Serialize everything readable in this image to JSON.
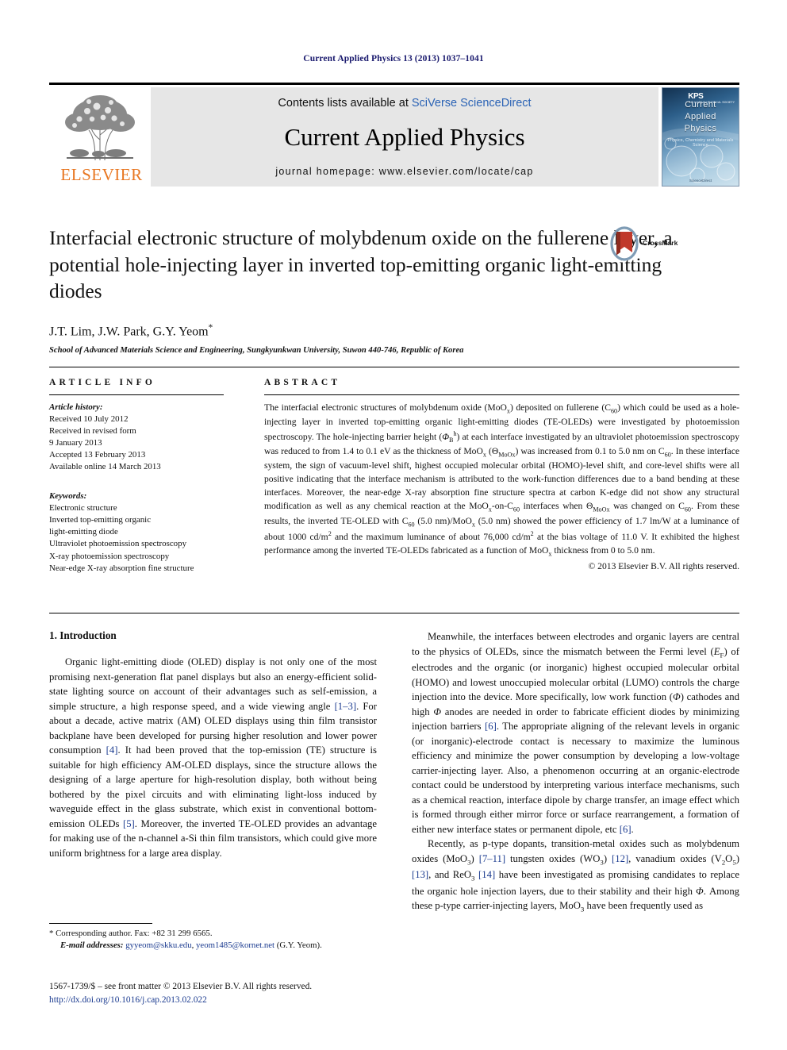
{
  "running_head": "Current Applied Physics 13 (2013) 1037–1041",
  "masthead": {
    "publisher_name": "ELSEVIER",
    "contents_prefix": "Contents lists available at ",
    "contents_link": "SciVerse ScienceDirect",
    "journal_title": "Current Applied Physics",
    "homepage_prefix": "journal homepage: ",
    "homepage_url": "www.elsevier.com/locate/cap",
    "cover": {
      "line1": "Current",
      "line2": "Applied",
      "line3": "Physics",
      "subtitle": "Physics, Chemistry and Materials Science",
      "society": "KPS",
      "society_sub": "THE KOREAN PHYSICAL SOCIETY",
      "bottom": "ScienceDirect"
    }
  },
  "article": {
    "title": "Interfacial electronic structure of molybdenum oxide on the fullerene layer, a potential hole-injecting layer in inverted top-emitting organic light-emitting diodes",
    "authors": "J.T. Lim, J.W. Park, G.Y. Yeom",
    "author_mark": "*",
    "affiliation": "School of Advanced Materials Science and Engineering, Sungkyunkwan University, Suwon 440-746, Republic of Korea",
    "crossmark_label": "CrossMark"
  },
  "article_info": {
    "heading": "ARTICLE INFO",
    "history_label": "Article history:",
    "history": [
      "Received 10 July 2012",
      "Received in revised form",
      "9 January 2013",
      "Accepted 13 February 2013",
      "Available online 14 March 2013"
    ],
    "keywords_label": "Keywords:",
    "keywords": [
      "Electronic structure",
      "Inverted top-emitting organic",
      "light-emitting diode",
      "Ultraviolet photoemission spectroscopy",
      "X-ray photoemission spectroscopy",
      "Near-edge X-ray absorption fine structure"
    ]
  },
  "abstract": {
    "heading": "ABSTRACT",
    "copyright": "© 2013 Elsevier B.V. All rights reserved."
  },
  "body": {
    "section1_heading": "1. Introduction",
    "footnote_corresponding": "* Corresponding author. Fax: +82 31 299 6565.",
    "footnote_email_label": "E-mail addresses:",
    "footnote_email1": "gyyeom@skku.edu",
    "footnote_email2": "yeom1485@kornet.net",
    "footnote_email_suffix": "(G.Y. Yeom).",
    "copyright_line": "1567-1739/$ – see front matter © 2013 Elsevier B.V. All rights reserved.",
    "doi": "http://dx.doi.org/10.1016/j.cap.2013.02.022"
  },
  "colors": {
    "link": "#2b63b5",
    "reference": "#1a3a8f",
    "elsevier_orange": "#e87722",
    "runhead": "#1a1a6e"
  }
}
